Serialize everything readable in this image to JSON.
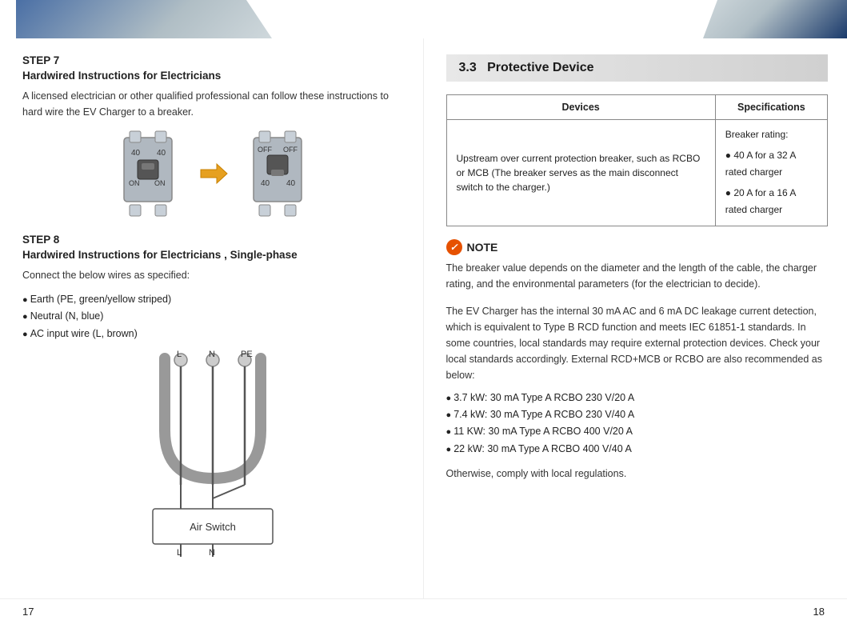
{
  "header": {
    "left_shape": true,
    "right_shape": true
  },
  "left": {
    "step7": {
      "label": "STEP 7",
      "subtitle": "Hardwired Instructions for Electricians",
      "text": "A licensed electrician or other qualified professional can follow these instructions to hard wire the EV Charger to a breaker."
    },
    "step8": {
      "label": "STEP 8",
      "subtitle": "Hardwired Instructions for Electricians , Single-phase",
      "intro": "Connect the below wires as specified:",
      "bullets": [
        "Earth (PE, green/yellow striped)",
        "Neutral (N, blue)",
        "AC input wire (L, brown)"
      ]
    },
    "diagram": {
      "breaker_label_on": "ON",
      "breaker_label_off": "OFF",
      "breaker_value": "40",
      "arrow": "→",
      "air_switch_label": "Air Switch",
      "wire_labels_top": [
        "L",
        "N",
        "PE"
      ],
      "wire_labels_bottom": [
        "L",
        "N"
      ]
    }
  },
  "right": {
    "section": {
      "number": "3.3",
      "title": "Protective Device"
    },
    "table": {
      "headers": [
        "Devices",
        "Specifications"
      ],
      "rows": [
        {
          "device": "Upstream over current protection breaker, such as RCBO or MCB (The breaker serves as the main disconnect switch to the charger.)",
          "spec_header": "Breaker rating:",
          "spec_bullets": [
            "40 A for a 32 A rated charger",
            "20 A for a 16 A rated charger"
          ]
        }
      ]
    },
    "note": {
      "title": "NOTE",
      "text1": "The breaker value depends on the diameter and the length of the cable, the charger rating, and the environmental parameters (for the electrician to decide).",
      "text2": "The EV Charger has the internal 30 mA AC and 6 mA DC leakage current detection, which is equivalent to Type B RCD function and meets IEC 61851-1 standards. In some countries, local standards may require external protection devices. Check your local standards accordingly. External RCD+MCB or RCBO are also recommended as below:",
      "bullets": [
        "3.7 kW: 30 mA Type A RCBO 230 V/20 A",
        "7.4 kW: 30 mA Type A RCBO 230 V/40 A",
        "11 KW: 30 mA Type A RCBO 400 V/20 A",
        "22 kW: 30 mA Type A RCBO 400 V/40 A"
      ],
      "text3": "Otherwise, comply with local regulations."
    }
  },
  "footer": {
    "left_page": "17",
    "right_page": "18"
  }
}
